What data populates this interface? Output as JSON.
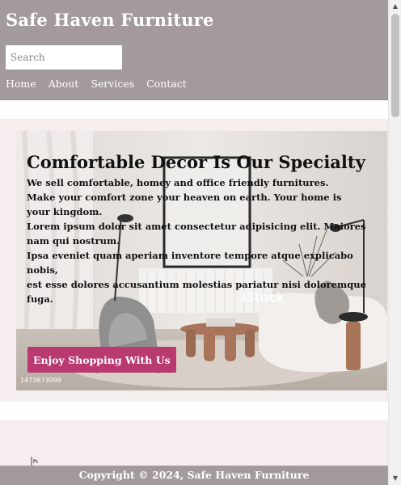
{
  "header": {
    "title": "Safe Haven Furniture",
    "search_placeholder": "Search",
    "nav": [
      "Home",
      "About",
      "Services",
      "Contact"
    ]
  },
  "hero": {
    "title": "Comfortable Decor Is Our Specialty",
    "text": "We sell comfortable, homey and office friendly furnitures.\nMake your comfort zone your heaven on earth. Your home is your kingdom.\nLorem ipsum dolor sit amet consectetur adipisicing elit. Maiores nam qui nostrum.\nIpsa eveniet quam aperiam inventore tempore atque explicabo nobis,\nest esse dolores accusantium molestias pariatur nisi doloremque fuga.",
    "button_label": "Enjoy Shopping With Us",
    "watermark": "iStock",
    "stock_id": "1473673099"
  },
  "footer": {
    "copyright": "Copyright © 2024, Safe Haven Furniture"
  },
  "icons": {
    "scroll_up": "triangle-up-icon",
    "scroll_down": "triangle-down-icon",
    "broken_image": "broken-image-icon"
  },
  "colors": {
    "header_bg": "#a39a9b",
    "band_bg": "#f6eeee",
    "button_bg": "#b83a70"
  }
}
